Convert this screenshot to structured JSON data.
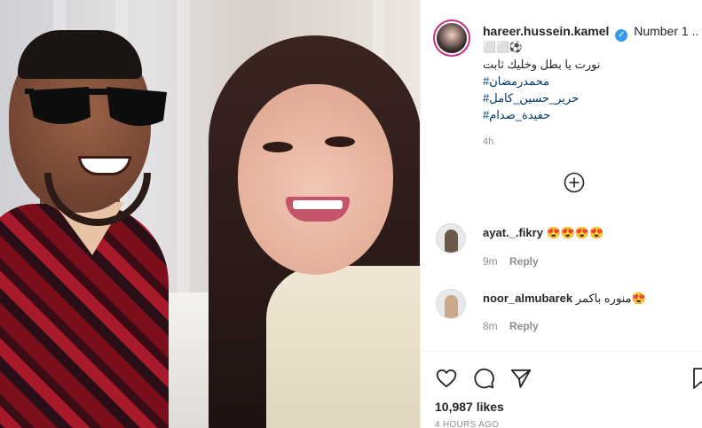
{
  "post": {
    "author": {
      "username": "hareer.hussein.kamel",
      "verified": true,
      "verified_icon": "check-badge-icon"
    },
    "caption": {
      "lead": "Number 1 ..",
      "emoji_line": "⬜⬜⚽",
      "line_arabic": "نورت يا بطل وخليك ثابت",
      "hashtags": [
        "#محمدرمضان",
        "#حرير_حسين_كامل",
        "#حفيدة_صدام"
      ],
      "age": "4h"
    },
    "load_more_icon": "plus-circle-icon",
    "comments": [
      {
        "username": "ayat._.fikry",
        "text": "😍😍😍😍",
        "age": "9m",
        "reply_label": "Reply"
      },
      {
        "username": "noor_almubarek",
        "text": "منوره باكمر😍",
        "age": "8m",
        "reply_label": "Reply"
      }
    ],
    "actions": {
      "like_icon": "heart-icon",
      "comment_icon": "comment-icon",
      "share_icon": "paper-plane-icon",
      "save_icon": "bookmark-icon"
    },
    "likes": "10,987 likes",
    "timestamp": "4 HOURS AGO"
  },
  "colors": {
    "link": "#00376b",
    "verified": "#3897f0",
    "muted": "#8e8e8e",
    "story_ring": "#c13584"
  }
}
